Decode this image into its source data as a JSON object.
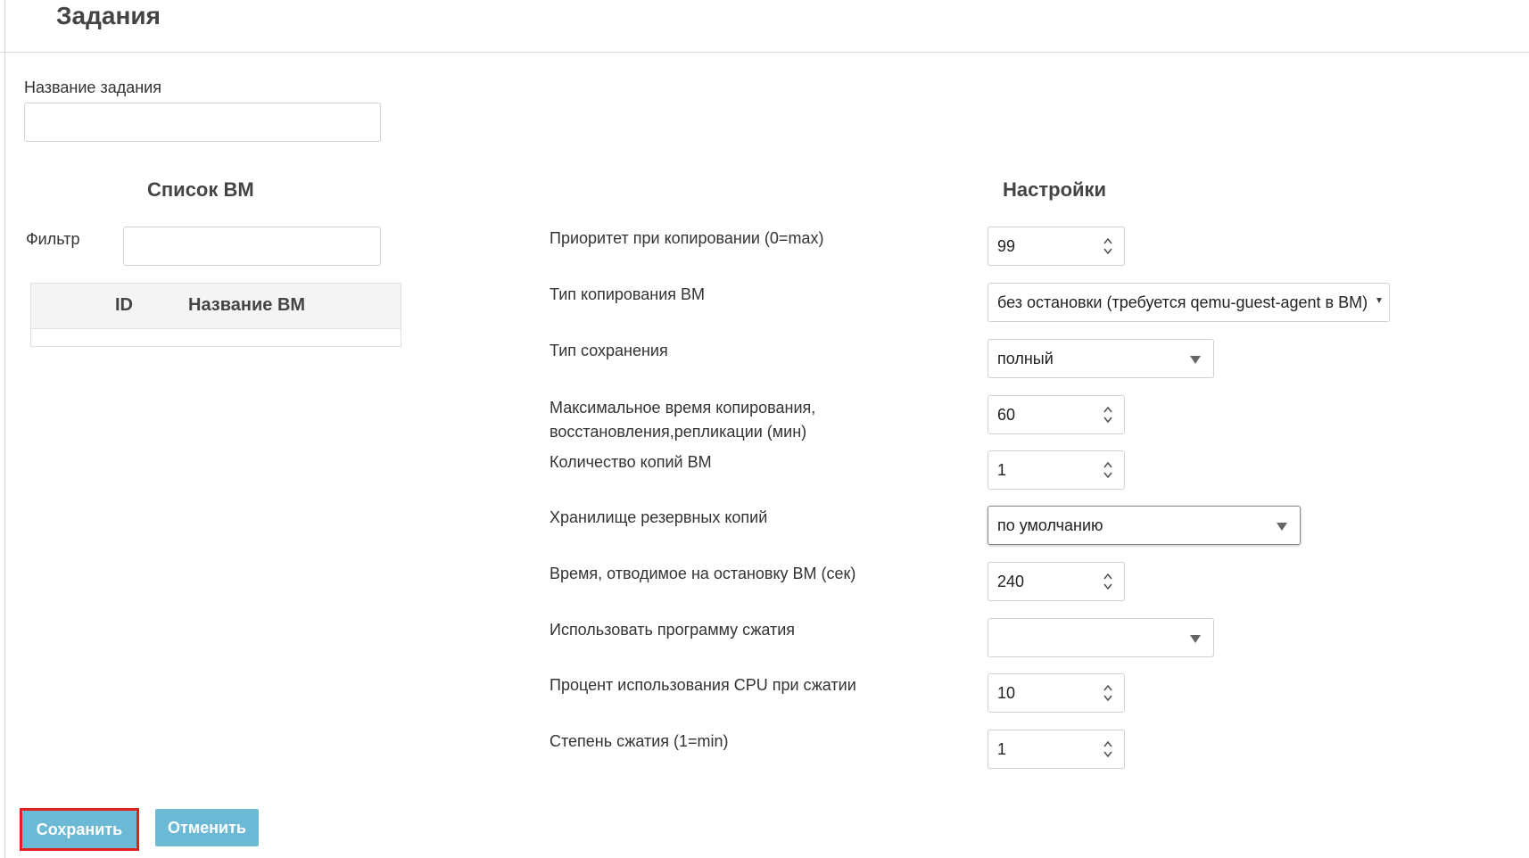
{
  "header": {
    "title": "Задания"
  },
  "form": {
    "job_name_label": "Название задания",
    "job_name_value": ""
  },
  "vm_list": {
    "title": "Список ВМ",
    "filter_label": "Фильтр",
    "filter_value": "",
    "columns": [
      "ID",
      "Название ВМ"
    ],
    "rows": []
  },
  "settings": {
    "title": "Настройки",
    "items": [
      {
        "label": "Приоритет при копировании (0=max)",
        "type": "number",
        "value": "99"
      },
      {
        "label": "Тип копирования ВМ",
        "type": "select",
        "value": "без остановки (требуется qemu-guest-agent в ВМ)"
      },
      {
        "label": "Тип сохранения",
        "type": "select",
        "value": "полный"
      },
      {
        "label": "Максимальное время копирования, восстановления,репликации (мин)",
        "type": "number",
        "value": "60"
      },
      {
        "label": "Количество копий ВМ",
        "type": "number",
        "value": "1"
      },
      {
        "label": "Хранилище резервных копий",
        "type": "select",
        "value": "по умолчанию"
      },
      {
        "label": "Время, отводимое на остановку ВМ (сек)",
        "type": "number",
        "value": "240"
      },
      {
        "label": "Использовать программу сжатия",
        "type": "select",
        "value": ""
      },
      {
        "label": "Процент использования CPU при сжатии",
        "type": "number",
        "value": "10"
      },
      {
        "label": "Степень сжатия (1=min)",
        "type": "number",
        "value": "1"
      }
    ]
  },
  "buttons": {
    "save": "Сохранить",
    "cancel": "Отменить"
  },
  "colors": {
    "button": "#6bb9d4",
    "highlight": "#e02020"
  },
  "icons": {
    "spinner": "updown-arrows-icon",
    "dropdown": "chevron-down-icon"
  }
}
